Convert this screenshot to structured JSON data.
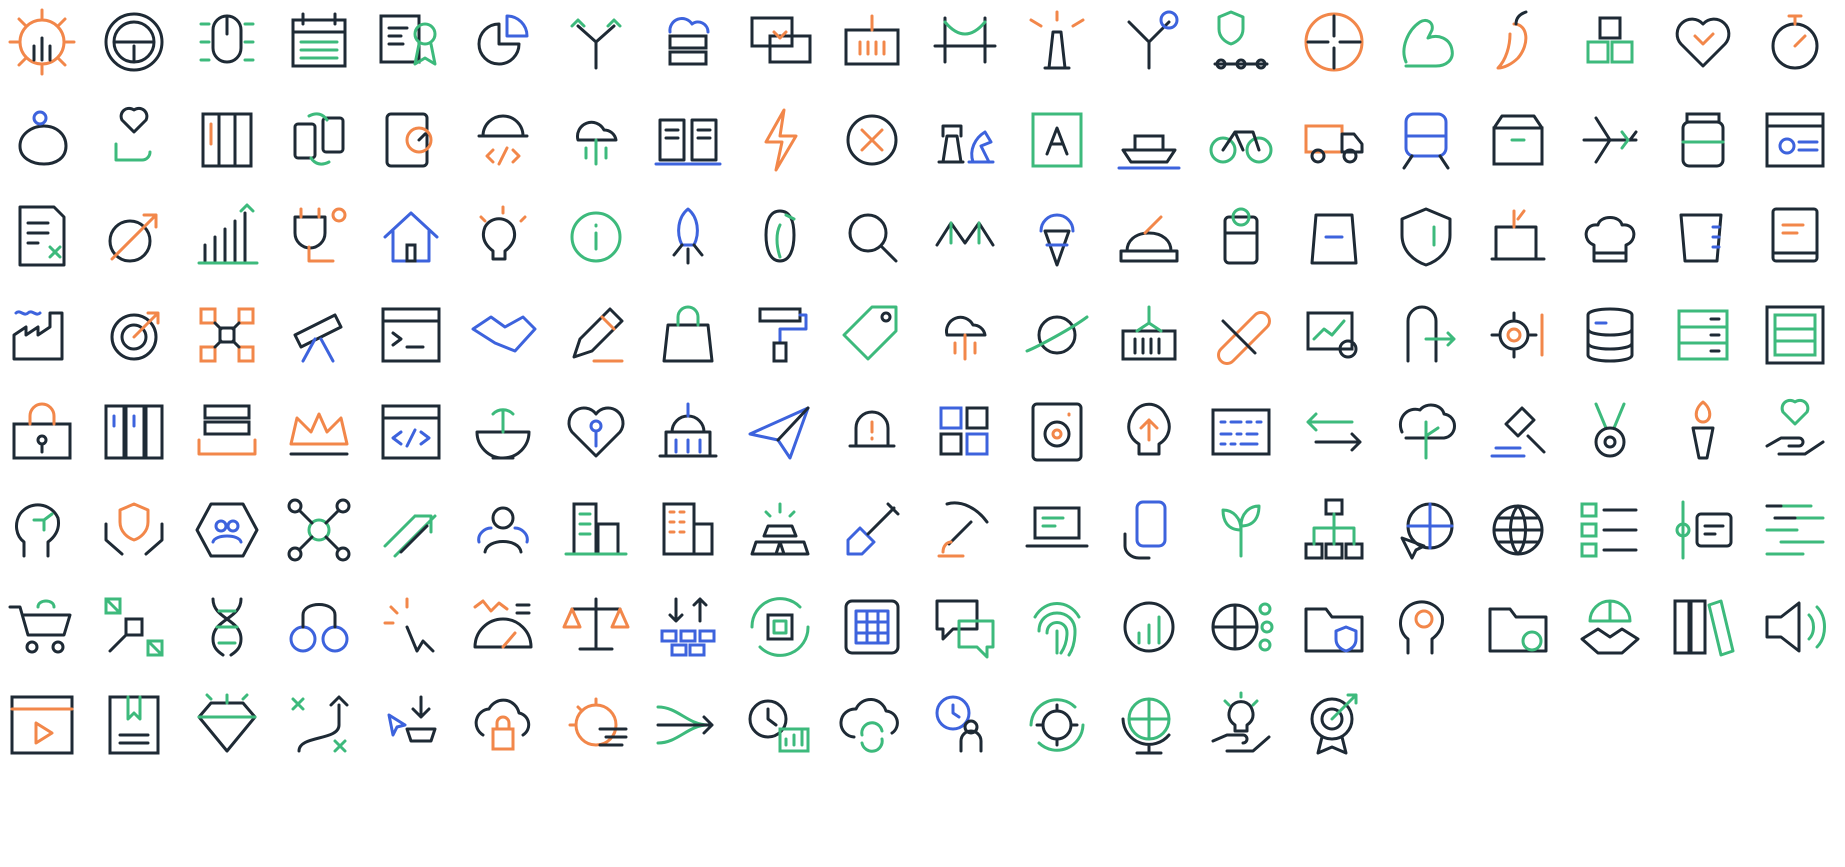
{
  "colors": {
    "dark": "#1e2a35",
    "orange": "#f2874a",
    "green": "#3dba7c",
    "blue": "#3d63dd",
    "background": "#ffffff"
  },
  "rows": [
    [
      {
        "icon": "gear-innovation-icon",
        "accent": "orange"
      },
      {
        "icon": "steering-wheel-icon",
        "accent": "dark"
      },
      {
        "icon": "computer-mouse-bug-icon",
        "accent": "green"
      },
      {
        "icon": "calendar-table-icon",
        "accent": "green"
      },
      {
        "icon": "certificate-award-icon",
        "accent": "green"
      },
      {
        "icon": "pie-chart-icon",
        "accent": "blue"
      },
      {
        "icon": "split-arrows-icon",
        "accent": "green"
      },
      {
        "icon": "cloud-server-icon",
        "accent": "blue"
      },
      {
        "icon": "chat-exchange-icon",
        "accent": "orange"
      },
      {
        "icon": "shipping-container-icon",
        "accent": "orange"
      },
      {
        "icon": "bridge-icon",
        "accent": "green"
      },
      {
        "icon": "lighthouse-icon",
        "accent": "orange"
      },
      {
        "icon": "y-connector-icon",
        "accent": "blue"
      },
      {
        "icon": "shield-network-icon",
        "accent": "green"
      },
      {
        "icon": "compress-arrows-icon",
        "accent": "orange"
      },
      {
        "icon": "flexed-arm-icon",
        "accent": "green"
      },
      {
        "icon": "chili-pepper-icon",
        "accent": "orange"
      },
      {
        "icon": "cubes-icon",
        "accent": "green"
      },
      {
        "icon": "puzzle-heart-icon",
        "accent": "orange"
      },
      {
        "icon": "stopwatch-icon",
        "accent": "orange"
      }
    ],
    [
      {
        "icon": "piggy-bank-user-icon",
        "accent": "blue"
      },
      {
        "icon": "heart-hand-icon",
        "accent": "green"
      },
      {
        "icon": "server-rack-icon",
        "accent": "orange"
      },
      {
        "icon": "mobile-sync-icon",
        "accent": "green"
      },
      {
        "icon": "tablet-gear-icon",
        "accent": "orange"
      },
      {
        "icon": "code-dome-icon",
        "accent": "orange"
      },
      {
        "icon": "cloud-circuit-icon",
        "accent": "green"
      },
      {
        "icon": "open-book-icon",
        "accent": "blue"
      },
      {
        "icon": "lightning-bolt-icon",
        "accent": "orange"
      },
      {
        "icon": "close-circle-icon",
        "accent": "orange"
      },
      {
        "icon": "chess-pieces-icon",
        "accent": "blue"
      },
      {
        "icon": "letter-a-frame-icon",
        "accent": "green"
      },
      {
        "icon": "cargo-ship-icon",
        "accent": "blue"
      },
      {
        "icon": "bicycle-icon",
        "accent": "green"
      },
      {
        "icon": "delivery-truck-icon",
        "accent": "orange"
      },
      {
        "icon": "train-icon",
        "accent": "blue"
      },
      {
        "icon": "box-icon",
        "accent": "green"
      },
      {
        "icon": "airplane-icon",
        "accent": "green"
      },
      {
        "icon": "jar-icon",
        "accent": "green"
      },
      {
        "icon": "browser-settings-icon",
        "accent": "blue"
      }
    ],
    [
      {
        "icon": "calculator-document-icon",
        "accent": "green"
      },
      {
        "icon": "growth-curve-icon",
        "accent": "orange"
      },
      {
        "icon": "bar-chart-growth-icon",
        "accent": "green"
      },
      {
        "icon": "idea-plug-icon",
        "accent": "orange"
      },
      {
        "icon": "house-icon",
        "accent": "blue"
      },
      {
        "icon": "lightbulb-icon",
        "accent": "orange"
      },
      {
        "icon": "info-icon",
        "accent": "green"
      },
      {
        "icon": "rocket-icon",
        "accent": "blue"
      },
      {
        "icon": "penguin-icon",
        "accent": "green"
      },
      {
        "icon": "search-icon",
        "accent": "dark"
      },
      {
        "icon": "croissant-icon",
        "accent": "green"
      },
      {
        "icon": "ice-cream-icon",
        "accent": "blue"
      },
      {
        "icon": "baking-icon",
        "accent": "orange"
      },
      {
        "icon": "canned-food-icon",
        "accent": "green"
      },
      {
        "icon": "coffee-bag-icon",
        "accent": "blue"
      },
      {
        "icon": "shield-icon",
        "accent": "green"
      },
      {
        "icon": "sewing-machine-icon",
        "accent": "orange"
      },
      {
        "icon": "chef-hat-icon",
        "accent": "dark"
      },
      {
        "icon": "measuring-cup-icon",
        "accent": "blue"
      },
      {
        "icon": "book-icon",
        "accent": "orange"
      }
    ],
    [
      {
        "icon": "factory-icon",
        "accent": "blue"
      },
      {
        "icon": "target-icon",
        "accent": "orange"
      },
      {
        "icon": "network-nodes-icon",
        "accent": "orange"
      },
      {
        "icon": "telescope-icon",
        "accent": "blue"
      },
      {
        "icon": "terminal-window-icon",
        "accent": "dark"
      },
      {
        "icon": "handshake-icon",
        "accent": "blue"
      },
      {
        "icon": "pencil-icon",
        "accent": "orange"
      },
      {
        "icon": "shopping-bag-icon",
        "accent": "green"
      },
      {
        "icon": "paint-roller-icon",
        "accent": "blue"
      },
      {
        "icon": "price-tag-icon",
        "accent": "green"
      },
      {
        "icon": "cloud-circuit-icon",
        "accent": "orange"
      },
      {
        "icon": "planet-icon",
        "accent": "green"
      },
      {
        "icon": "container-crane-icon",
        "accent": "green"
      },
      {
        "icon": "bandage-icon",
        "accent": "orange"
      },
      {
        "icon": "analytics-search-icon",
        "accent": "green"
      },
      {
        "icon": "door-exit-icon",
        "accent": "green"
      },
      {
        "icon": "gear-settings-icon",
        "accent": "orange"
      },
      {
        "icon": "database-icon",
        "accent": "blue"
      },
      {
        "icon": "server-icon",
        "accent": "green"
      },
      {
        "icon": "server-frame-icon",
        "accent": "green"
      }
    ],
    [
      {
        "icon": "lock-case-icon",
        "accent": "orange"
      },
      {
        "icon": "file-cabinets-icon",
        "accent": "blue"
      },
      {
        "icon": "stack-layers-icon",
        "accent": "orange"
      },
      {
        "icon": "crown-icon",
        "accent": "orange"
      },
      {
        "icon": "code-window-icon",
        "accent": "blue"
      },
      {
        "icon": "satellite-dish-icon",
        "accent": "green"
      },
      {
        "icon": "heart-key-icon",
        "accent": "blue"
      },
      {
        "icon": "capitol-building-icon",
        "accent": "blue"
      },
      {
        "icon": "paper-plane-icon",
        "accent": "blue"
      },
      {
        "icon": "alarm-bell-icon",
        "accent": "orange"
      },
      {
        "icon": "puzzle-blocks-icon",
        "accent": "blue"
      },
      {
        "icon": "safe-icon",
        "accent": "orange"
      },
      {
        "icon": "brain-bulb-icon",
        "accent": "orange"
      },
      {
        "icon": "binary-board-icon",
        "accent": "blue"
      },
      {
        "icon": "exchange-arrows-icon",
        "accent": "green"
      },
      {
        "icon": "brain-tree-icon",
        "accent": "green"
      },
      {
        "icon": "gavel-icon",
        "accent": "blue"
      },
      {
        "icon": "medal-icon",
        "accent": "green"
      },
      {
        "icon": "torch-icon",
        "accent": "orange"
      },
      {
        "icon": "heart-in-hand-icon",
        "accent": "green"
      }
    ],
    [
      {
        "icon": "head-circuit-icon",
        "accent": "green"
      },
      {
        "icon": "hands-shield-icon",
        "accent": "orange"
      },
      {
        "icon": "team-network-icon",
        "accent": "blue"
      },
      {
        "icon": "hub-nodes-icon",
        "accent": "green"
      },
      {
        "icon": "growth-arrows-icon",
        "accent": "green"
      },
      {
        "icon": "user-group-icon",
        "accent": "blue"
      },
      {
        "icon": "city-buildings-icon",
        "accent": "green"
      },
      {
        "icon": "office-building-icon",
        "accent": "orange"
      },
      {
        "icon": "gold-bars-icon",
        "accent": "green"
      },
      {
        "icon": "shovel-icon",
        "accent": "blue"
      },
      {
        "icon": "pickaxe-icon",
        "accent": "orange"
      },
      {
        "icon": "laptop-icon",
        "accent": "green"
      },
      {
        "icon": "smartphone-hand-icon",
        "accent": "blue"
      },
      {
        "icon": "plant-icon",
        "accent": "green"
      },
      {
        "icon": "org-chart-icon",
        "accent": "green"
      },
      {
        "icon": "globe-cursor-icon",
        "accent": "blue"
      },
      {
        "icon": "globe-icon",
        "accent": "green"
      },
      {
        "icon": "checklist-icon",
        "accent": "green"
      },
      {
        "icon": "timeline-icon",
        "accent": "green"
      },
      {
        "icon": "gantt-bars-icon",
        "accent": "green"
      }
    ],
    [
      {
        "icon": "shopping-cart-icon",
        "accent": "green"
      },
      {
        "icon": "satellite-icon",
        "accent": "green"
      },
      {
        "icon": "dna-icon",
        "accent": "green"
      },
      {
        "icon": "handcuffs-icon",
        "accent": "blue"
      },
      {
        "icon": "mouse-click-icon",
        "accent": "orange"
      },
      {
        "icon": "gauge-chart-icon",
        "accent": "orange"
      },
      {
        "icon": "scales-icon",
        "accent": "orange"
      },
      {
        "icon": "sort-blocks-icon",
        "accent": "blue"
      },
      {
        "icon": "chip-cycle-icon",
        "accent": "green"
      },
      {
        "icon": "grid-app-icon",
        "accent": "blue"
      },
      {
        "icon": "speech-bubbles-icon",
        "accent": "green"
      },
      {
        "icon": "fingerprint-icon",
        "accent": "green"
      },
      {
        "icon": "gear-chart-icon",
        "accent": "green"
      },
      {
        "icon": "globe-network-icon",
        "accent": "green"
      },
      {
        "icon": "folder-shield-icon",
        "accent": "blue"
      },
      {
        "icon": "head-gear-icon",
        "accent": "orange"
      },
      {
        "icon": "folder-gear-icon",
        "accent": "green"
      },
      {
        "icon": "globe-handshake-icon",
        "accent": "green"
      },
      {
        "icon": "books-icon",
        "accent": "green"
      },
      {
        "icon": "speaker-icon",
        "accent": "green"
      }
    ],
    [
      {
        "icon": "video-player-icon",
        "accent": "orange"
      },
      {
        "icon": "bookmark-book-icon",
        "accent": "green"
      },
      {
        "icon": "diamond-icon",
        "accent": "green"
      },
      {
        "icon": "path-strategy-icon",
        "accent": "green"
      },
      {
        "icon": "cursor-download-icon",
        "accent": "blue"
      },
      {
        "icon": "cloud-lock-icon",
        "accent": "orange"
      },
      {
        "icon": "fast-gear-icon",
        "accent": "orange"
      },
      {
        "icon": "merge-arrows-icon",
        "accent": "green"
      },
      {
        "icon": "time-chart-icon",
        "accent": "green"
      },
      {
        "icon": "cloud-sync-icon",
        "accent": "green"
      },
      {
        "icon": "clock-person-icon",
        "accent": "blue"
      },
      {
        "icon": "gear-cycle-icon",
        "accent": "green"
      },
      {
        "icon": "globe-stand-icon",
        "accent": "green"
      },
      {
        "icon": "idea-hand-icon",
        "accent": "green"
      },
      {
        "icon": "target-award-icon",
        "accent": "green"
      }
    ]
  ]
}
